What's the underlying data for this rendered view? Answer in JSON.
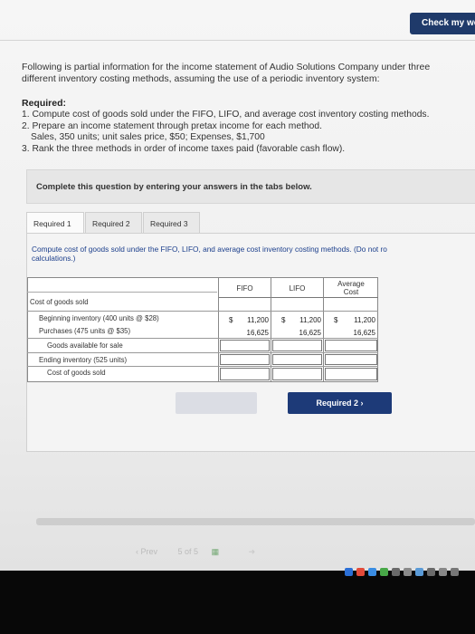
{
  "header": {
    "check_label": "Check my wo"
  },
  "intro": "Following is partial information for the income statement of Audio Solutions Company under three different inventory costing methods, assuming the use of a periodic inventory system:",
  "required": {
    "heading": "Required:",
    "items": [
      "1. Compute cost of goods sold under the FIFO, LIFO, and average cost inventory costing methods.",
      "2. Prepare an income statement through pretax income for each method.",
      "Sales, 350 units; unit sales price, $50; Expenses, $1,700",
      "3. Rank the three methods in order of income taxes paid (favorable cash flow)."
    ]
  },
  "instruction": "Complete this question by entering your answers in the tabs below.",
  "tabs": [
    "Required 1",
    "Required 2",
    "Required 3"
  ],
  "prompt_line1": "Compute cost of goods sold under the FIFO, LIFO, and average cost inventory costing methods. (Do not ro",
  "prompt_line2": "calculations.)",
  "table": {
    "columns": [
      "FIFO",
      "LIFO",
      "Average Cost"
    ],
    "rows": [
      "Cost of goods sold",
      "Beginning inventory (400 units @ $28)",
      "Purchases (475 units @ $35)",
      "Goods available for sale",
      "Ending inventory (525 units)",
      "Cost of goods sold"
    ],
    "currency": "$",
    "beginning": [
      "11,200",
      "11,200",
      "11,200"
    ],
    "purchases": [
      "16,625",
      "16,625",
      "16,625"
    ]
  },
  "next_label": "Required 2  ›",
  "footer": {
    "prev": "‹ Prev",
    "page": "5 of 5"
  }
}
